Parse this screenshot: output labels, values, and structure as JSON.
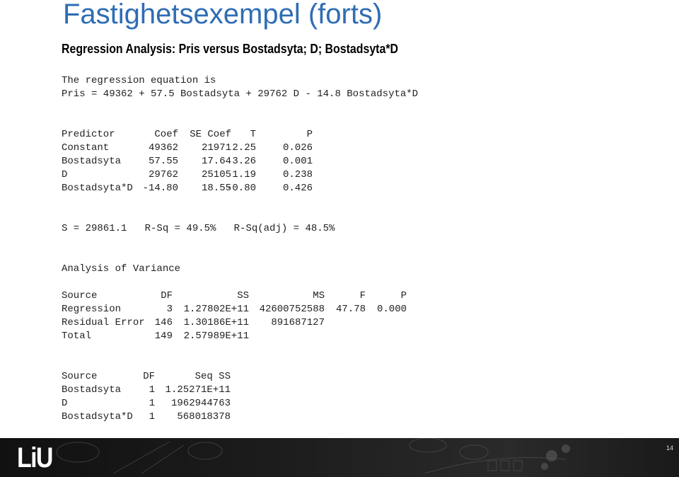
{
  "slide": {
    "title": "Fastighetsexempel (forts)",
    "subtitle": "Regression Analysis: Pris versus Bostadsyta; D; Bostadsyta*D",
    "page_number": "14",
    "logo_text": "LiU",
    "title_color": "#2f6db4"
  },
  "equation": {
    "intro": "The regression equation is",
    "formula": "Pris = 49362 + 57.5 Bostadsyta + 29762 D - 14.8 Bostadsyta*D"
  },
  "coef_table": {
    "headers": [
      "Predictor",
      "Coef",
      "SE Coef",
      "T",
      "P"
    ],
    "rows": [
      [
        "Constant",
        "49362",
        "21971",
        "2.25",
        "0.026"
      ],
      [
        "Bostadsyta",
        "57.55",
        "17.64",
        "3.26",
        "0.001"
      ],
      [
        "D",
        "29762",
        "25105",
        "1.19",
        "0.238"
      ],
      [
        "Bostadsyta*D",
        "-14.80",
        "18.55",
        "-0.80",
        "0.426"
      ]
    ]
  },
  "fit_summary": "S = 29861.1   R-Sq = 49.5%   R-Sq(adj) = 48.5%",
  "anova": {
    "title": "Analysis of Variance",
    "headers": [
      "Source",
      "DF",
      "SS",
      "MS",
      "F",
      "P"
    ],
    "rows": [
      [
        "Regression",
        "3",
        "1.27802E+11",
        "42600752588",
        "47.78",
        "0.000"
      ],
      [
        "Residual Error",
        "146",
        "1.30186E+11",
        "891687127",
        "",
        ""
      ],
      [
        "Total",
        "149",
        "2.57989E+11",
        "",
        "",
        ""
      ]
    ]
  },
  "seq_table": {
    "headers": [
      "Source",
      "DF",
      "Seq SS"
    ],
    "rows": [
      [
        "Bostadsyta",
        "1",
        "1.25271E+11"
      ],
      [
        "D",
        "1",
        "1962944763"
      ],
      [
        "Bostadsyta*D",
        "1",
        "568018378"
      ]
    ]
  }
}
